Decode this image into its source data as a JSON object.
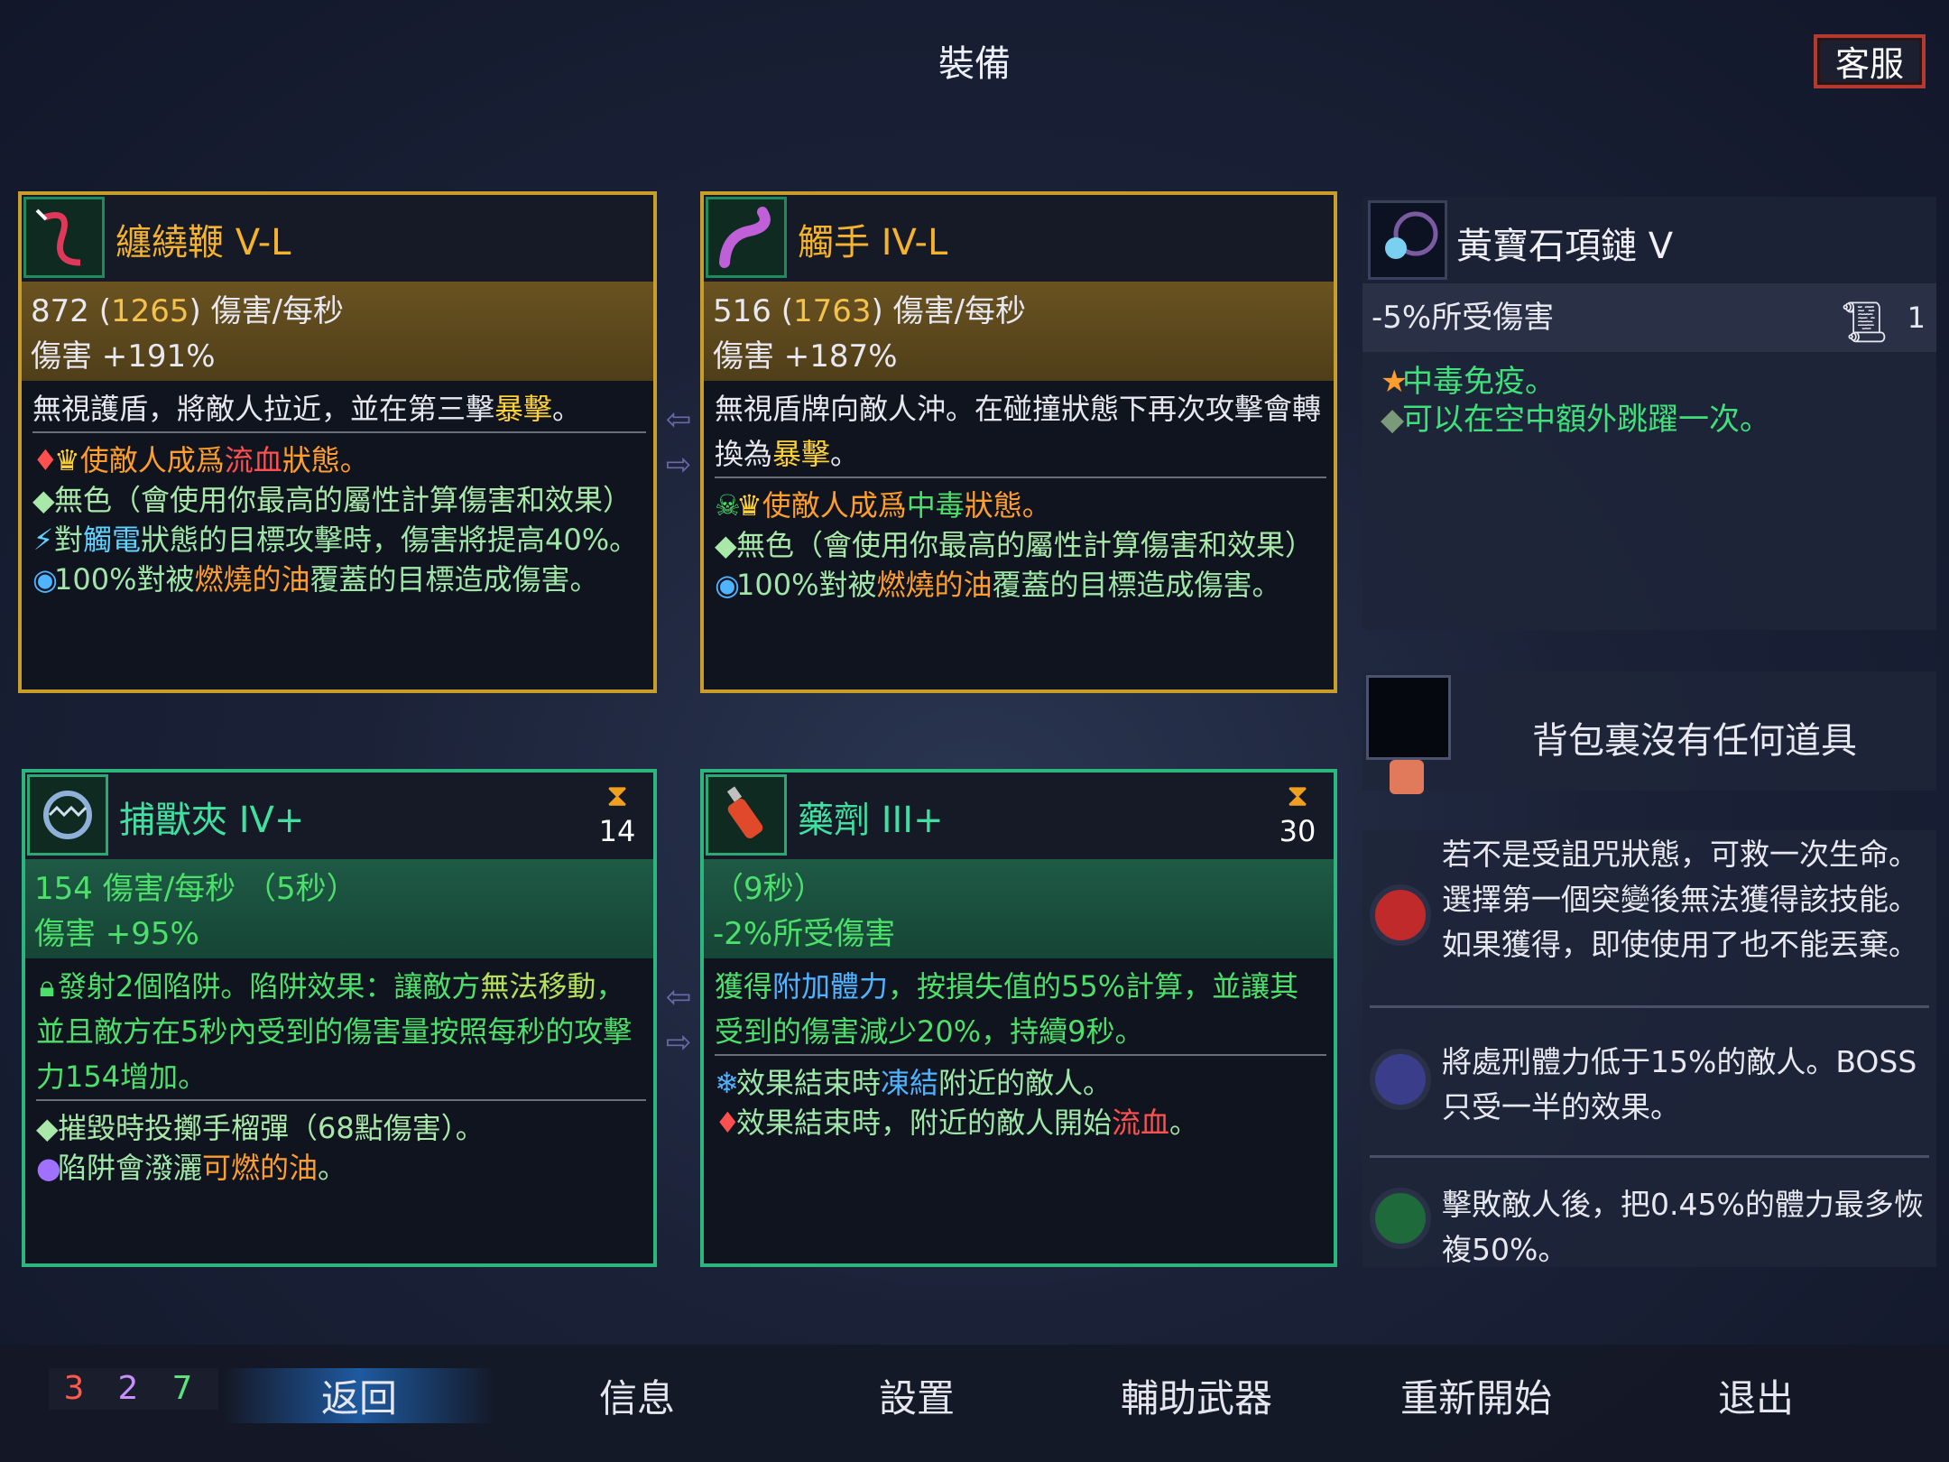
{
  "title": "裝備",
  "service_button": "客服",
  "weapons": [
    {
      "name": "纏繞鞭 V-L",
      "dps_main": "872",
      "dps_alt": "1265",
      "dps_suffix": "傷害/每秒",
      "damage": "傷害 +191%",
      "desc_a": "無視護盾，將敵人拉近，並在第三擊",
      "desc_b": "暴擊",
      "desc_c": "。",
      "e1a": "使敵人成爲",
      "e1b": "流血",
      "e1c": "狀態。",
      "e2": "無色（會使用你最高的屬性計算傷害和效果）",
      "e3a": "對",
      "e3b": "觸電",
      "e3c": "狀態的目標攻擊時，傷害將提高40%。",
      "e4a": "100%對被",
      "e4b": "燃燒的油",
      "e4c": "覆蓋的目標造成傷害。"
    },
    {
      "name": "觸手 IV-L",
      "dps_main": "516",
      "dps_alt": "1763",
      "dps_suffix": "傷害/每秒",
      "damage": "傷害 +187%",
      "desc_a": "無視盾牌向敵人沖。在碰撞狀態下再次攻擊會轉換為",
      "desc_b": "暴擊",
      "desc_c": "。",
      "e1a": "使敵人成爲",
      "e1b": "中毒",
      "e1c": "狀態。",
      "e2": "無色（會使用你最高的屬性計算傷害和效果）",
      "e4a": "100%對被",
      "e4b": "燃燒的油",
      "e4c": "覆蓋的目標造成傷害。"
    }
  ],
  "skills": [
    {
      "name": "捕獸夾 IV+",
      "cooldown": "14",
      "line1": "154 傷害/每秒 （5秒）",
      "line2": "傷害 +95%",
      "desc_a": "發射2個陷阱。陷阱效果：讓敵方",
      "desc_b": "無法移動",
      "desc_c": "，並且敵方在5秒內受到的傷害量按照每秒的攻擊力154增加。",
      "e1": "摧毀時投擲手榴彈（68點傷害）。",
      "e2a": "陷阱會潑灑",
      "e2b": "可燃的油",
      "e2c": "。"
    },
    {
      "name": "藥劑 III+",
      "cooldown": "30",
      "line1": "（9秒）",
      "line2": "-2%所受傷害",
      "desc_a": "獲得",
      "desc_b": "附加體力",
      "desc_c": "，按損失值的55%計算，並讓其受到的傷害減少20%，持續9秒。",
      "e1a": "效果結束時",
      "e1b": "凍結",
      "e1c": "附近的敵人。",
      "e2a": "效果結束時，附近的敵人開始",
      "e2b": "流血",
      "e2c": "。"
    }
  ],
  "amulet": {
    "name": "黃寶石項鏈 V",
    "stat": "-5%所受傷害",
    "scroll_count": "1",
    "effect1": "中毒免疫。",
    "effect2": "可以在空中額外跳躍一次。"
  },
  "backpack": {
    "empty_text": "背包裏沒有任何道具"
  },
  "mutations": [
    {
      "text": "若不是受詛咒狀態，可救一次生命。選擇第一個突變後無法獲得該技能。如果獲得，即使使用了也不能丟棄。",
      "icon": "heart-icon"
    },
    {
      "text": "將處刑體力低于15%的敵人。BOSS只受一半的效果。",
      "icon": "axe-icon"
    },
    {
      "text": "擊敗敵人後，把0.45%的體力最多恢複50%。",
      "icon": "fangs-icon"
    }
  ],
  "scroll_counts": [
    {
      "value": "3",
      "color": "#ff5a4a"
    },
    {
      "value": "2",
      "color": "#c890ff"
    },
    {
      "value": "7",
      "color": "#5ee07a"
    }
  ],
  "menu": [
    "返回",
    "信息",
    "設置",
    "輔助武器",
    "重新開始",
    "退出"
  ]
}
